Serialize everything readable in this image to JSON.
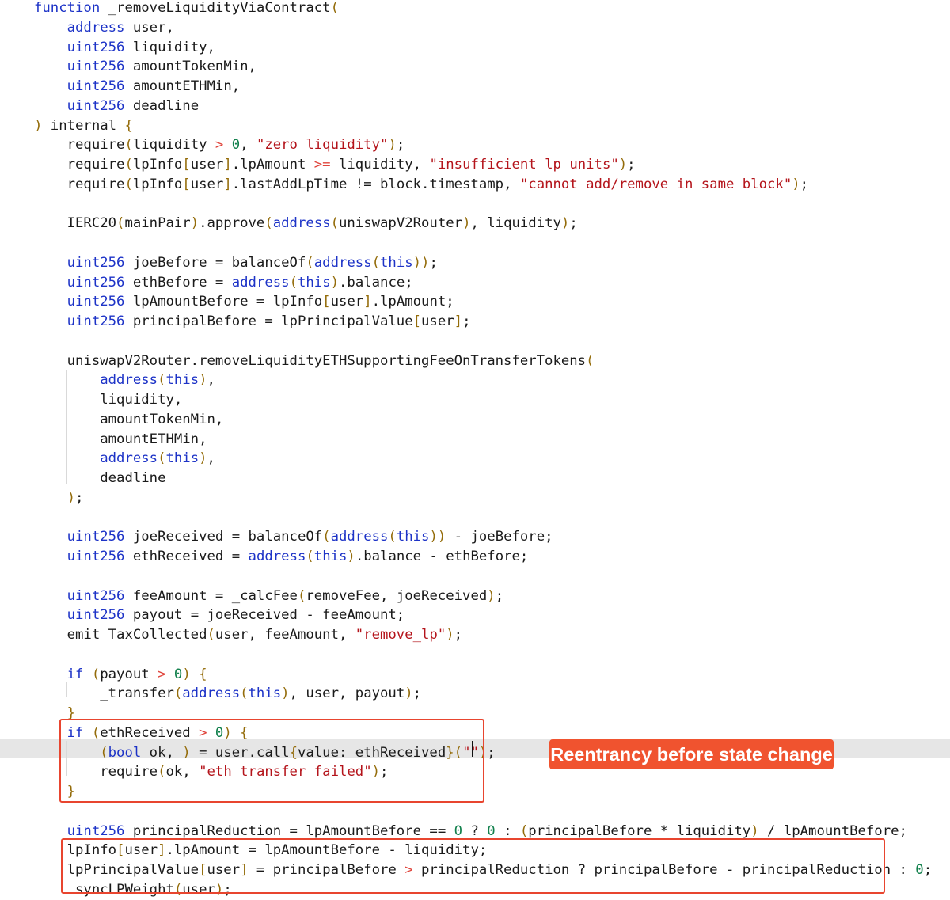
{
  "editor": {
    "lines": [
      [
        [
          "kw",
          "function"
        ],
        [
          "t",
          " _removeLiquidityViaContract"
        ],
        [
          "br",
          "("
        ]
      ],
      [
        [
          "t",
          "    "
        ],
        [
          "ty",
          "address"
        ],
        [
          "t",
          " user,"
        ]
      ],
      [
        [
          "t",
          "    "
        ],
        [
          "ty",
          "uint256"
        ],
        [
          "t",
          " liquidity,"
        ]
      ],
      [
        [
          "t",
          "    "
        ],
        [
          "ty",
          "uint256"
        ],
        [
          "t",
          " amountTokenMin,"
        ]
      ],
      [
        [
          "t",
          "    "
        ],
        [
          "ty",
          "uint256"
        ],
        [
          "t",
          " amountETHMin,"
        ]
      ],
      [
        [
          "t",
          "    "
        ],
        [
          "ty",
          "uint256"
        ],
        [
          "t",
          " deadline"
        ]
      ],
      [
        [
          "br",
          ")"
        ],
        [
          "t",
          " internal "
        ],
        [
          "br",
          "{"
        ]
      ],
      [
        [
          "t",
          "    require"
        ],
        [
          "br",
          "("
        ],
        [
          "t",
          "liquidity "
        ],
        [
          "op",
          ">"
        ],
        [
          "t",
          " "
        ],
        [
          "num",
          "0"
        ],
        [
          "t",
          ", "
        ],
        [
          "str",
          "\"zero liquidity\""
        ],
        [
          "br",
          ")"
        ],
        [
          "t",
          ";"
        ]
      ],
      [
        [
          "t",
          "    require"
        ],
        [
          "br",
          "("
        ],
        [
          "t",
          "lpInfo"
        ],
        [
          "br",
          "["
        ],
        [
          "t",
          "user"
        ],
        [
          "br",
          "]"
        ],
        [
          "t",
          ".lpAmount "
        ],
        [
          "op",
          ">="
        ],
        [
          "t",
          " liquidity, "
        ],
        [
          "str",
          "\"insufficient lp units\""
        ],
        [
          "br",
          ")"
        ],
        [
          "t",
          ";"
        ]
      ],
      [
        [
          "t",
          "    require"
        ],
        [
          "br",
          "("
        ],
        [
          "t",
          "lpInfo"
        ],
        [
          "br",
          "["
        ],
        [
          "t",
          "user"
        ],
        [
          "br",
          "]"
        ],
        [
          "t",
          ".lastAddLpTime != block.timestamp, "
        ],
        [
          "str",
          "\"cannot add/remove in same block\""
        ],
        [
          "br",
          ")"
        ],
        [
          "t",
          ";"
        ]
      ],
      [],
      [
        [
          "t",
          "    IERC20"
        ],
        [
          "br",
          "("
        ],
        [
          "t",
          "mainPair"
        ],
        [
          "br",
          ")"
        ],
        [
          "t",
          ".approve"
        ],
        [
          "br",
          "("
        ],
        [
          "ty",
          "address"
        ],
        [
          "br",
          "("
        ],
        [
          "t",
          "uniswapV2Router"
        ],
        [
          "br",
          ")"
        ],
        [
          "t",
          ", liquidity"
        ],
        [
          "br",
          ")"
        ],
        [
          "t",
          ";"
        ]
      ],
      [],
      [
        [
          "t",
          "    "
        ],
        [
          "ty",
          "uint256"
        ],
        [
          "t",
          " joeBefore = balanceOf"
        ],
        [
          "br",
          "("
        ],
        [
          "ty",
          "address"
        ],
        [
          "br",
          "("
        ],
        [
          "kw",
          "this"
        ],
        [
          "br",
          "))"
        ],
        [
          "t",
          ";"
        ]
      ],
      [
        [
          "t",
          "    "
        ],
        [
          "ty",
          "uint256"
        ],
        [
          "t",
          " ethBefore = "
        ],
        [
          "ty",
          "address"
        ],
        [
          "br",
          "("
        ],
        [
          "kw",
          "this"
        ],
        [
          "br",
          ")"
        ],
        [
          "t",
          ".balance;"
        ]
      ],
      [
        [
          "t",
          "    "
        ],
        [
          "ty",
          "uint256"
        ],
        [
          "t",
          " lpAmountBefore = lpInfo"
        ],
        [
          "br",
          "["
        ],
        [
          "t",
          "user"
        ],
        [
          "br",
          "]"
        ],
        [
          "t",
          ".lpAmount;"
        ]
      ],
      [
        [
          "t",
          "    "
        ],
        [
          "ty",
          "uint256"
        ],
        [
          "t",
          " principalBefore = lpPrincipalValue"
        ],
        [
          "br",
          "["
        ],
        [
          "t",
          "user"
        ],
        [
          "br",
          "]"
        ],
        [
          "t",
          ";"
        ]
      ],
      [],
      [
        [
          "t",
          "    uniswapV2Router.removeLiquidityETHSupportingFeeOnTransferTokens"
        ],
        [
          "br",
          "("
        ]
      ],
      [
        [
          "t",
          "        "
        ],
        [
          "ty",
          "address"
        ],
        [
          "br",
          "("
        ],
        [
          "kw",
          "this"
        ],
        [
          "br",
          ")"
        ],
        [
          "t",
          ","
        ]
      ],
      [
        [
          "t",
          "        liquidity,"
        ]
      ],
      [
        [
          "t",
          "        amountTokenMin,"
        ]
      ],
      [
        [
          "t",
          "        amountETHMin,"
        ]
      ],
      [
        [
          "t",
          "        "
        ],
        [
          "ty",
          "address"
        ],
        [
          "br",
          "("
        ],
        [
          "kw",
          "this"
        ],
        [
          "br",
          ")"
        ],
        [
          "t",
          ","
        ]
      ],
      [
        [
          "t",
          "        deadline"
        ]
      ],
      [
        [
          "t",
          "    "
        ],
        [
          "br",
          ")"
        ],
        [
          "t",
          ";"
        ]
      ],
      [],
      [
        [
          "t",
          "    "
        ],
        [
          "ty",
          "uint256"
        ],
        [
          "t",
          " joeReceived = balanceOf"
        ],
        [
          "br",
          "("
        ],
        [
          "ty",
          "address"
        ],
        [
          "br",
          "("
        ],
        [
          "kw",
          "this"
        ],
        [
          "br",
          "))"
        ],
        [
          "t",
          " - joeBefore;"
        ]
      ],
      [
        [
          "t",
          "    "
        ],
        [
          "ty",
          "uint256"
        ],
        [
          "t",
          " ethReceived = "
        ],
        [
          "ty",
          "address"
        ],
        [
          "br",
          "("
        ],
        [
          "kw",
          "this"
        ],
        [
          "br",
          ")"
        ],
        [
          "t",
          ".balance - ethBefore;"
        ]
      ],
      [],
      [
        [
          "t",
          "    "
        ],
        [
          "ty",
          "uint256"
        ],
        [
          "t",
          " feeAmount = _calcFee"
        ],
        [
          "br",
          "("
        ],
        [
          "t",
          "removeFee, joeReceived"
        ],
        [
          "br",
          ")"
        ],
        [
          "t",
          ";"
        ]
      ],
      [
        [
          "t",
          "    "
        ],
        [
          "ty",
          "uint256"
        ],
        [
          "t",
          " payout = joeReceived - feeAmount;"
        ]
      ],
      [
        [
          "t",
          "    emit TaxCollected"
        ],
        [
          "br",
          "("
        ],
        [
          "t",
          "user, feeAmount, "
        ],
        [
          "str",
          "\"remove_lp\""
        ],
        [
          "br",
          ")"
        ],
        [
          "t",
          ";"
        ]
      ],
      [],
      [
        [
          "t",
          "    "
        ],
        [
          "kw",
          "if"
        ],
        [
          "t",
          " "
        ],
        [
          "br",
          "("
        ],
        [
          "t",
          "payout "
        ],
        [
          "op",
          ">"
        ],
        [
          "t",
          " "
        ],
        [
          "num",
          "0"
        ],
        [
          "br",
          ")"
        ],
        [
          "t",
          " "
        ],
        [
          "br",
          "{"
        ]
      ],
      [
        [
          "t",
          "        _transfer"
        ],
        [
          "br",
          "("
        ],
        [
          "ty",
          "address"
        ],
        [
          "br",
          "("
        ],
        [
          "kw",
          "this"
        ],
        [
          "br",
          ")"
        ],
        [
          "t",
          ", user, payout"
        ],
        [
          "br",
          ")"
        ],
        [
          "t",
          ";"
        ]
      ],
      [
        [
          "t",
          "    "
        ],
        [
          "br",
          "}"
        ]
      ],
      [
        [
          "t",
          "    "
        ],
        [
          "kw",
          "if"
        ],
        [
          "t",
          " "
        ],
        [
          "br",
          "("
        ],
        [
          "t",
          "ethReceived "
        ],
        [
          "op",
          ">"
        ],
        [
          "t",
          " "
        ],
        [
          "num",
          "0"
        ],
        [
          "br",
          ")"
        ],
        [
          "t",
          " "
        ],
        [
          "br",
          "{"
        ]
      ],
      [
        [
          "t",
          "        "
        ],
        [
          "br",
          "("
        ],
        [
          "ty",
          "bool"
        ],
        [
          "t",
          " ok, "
        ],
        [
          "br",
          ")"
        ],
        [
          "t",
          " = user.call"
        ],
        [
          "br",
          "{"
        ],
        [
          "t",
          "value: ethReceived"
        ],
        [
          "br",
          "}"
        ],
        [
          "br",
          "("
        ],
        [
          "str",
          "\"\""
        ],
        [
          "br",
          ")"
        ],
        [
          "t",
          ";"
        ]
      ],
      [
        [
          "t",
          "        require"
        ],
        [
          "br",
          "("
        ],
        [
          "t",
          "ok, "
        ],
        [
          "str",
          "\"eth transfer failed\""
        ],
        [
          "br",
          ")"
        ],
        [
          "t",
          ";"
        ]
      ],
      [
        [
          "t",
          "    "
        ],
        [
          "br",
          "}"
        ]
      ],
      [],
      [
        [
          "t",
          "    "
        ],
        [
          "ty",
          "uint256"
        ],
        [
          "t",
          " principalReduction = lpAmountBefore == "
        ],
        [
          "num",
          "0"
        ],
        [
          "t",
          " ? "
        ],
        [
          "num",
          "0"
        ],
        [
          "t",
          " : "
        ],
        [
          "br",
          "("
        ],
        [
          "t",
          "principalBefore * liquidity"
        ],
        [
          "br",
          ")"
        ],
        [
          "t",
          " / lpAmountBefore;"
        ]
      ],
      [
        [
          "t",
          "    lpInfo"
        ],
        [
          "br",
          "["
        ],
        [
          "t",
          "user"
        ],
        [
          "br",
          "]"
        ],
        [
          "t",
          ".lpAmount = lpAmountBefore - liquidity;"
        ]
      ],
      [
        [
          "t",
          "    lpPrincipalValue"
        ],
        [
          "br",
          "["
        ],
        [
          "t",
          "user"
        ],
        [
          "br",
          "]"
        ],
        [
          "t",
          " = principalBefore "
        ],
        [
          "op",
          ">"
        ],
        [
          "t",
          " principalReduction ? principalBefore - principalReduction : "
        ],
        [
          "num",
          "0"
        ],
        [
          "t",
          ";"
        ]
      ],
      [
        [
          "t",
          "     syncLPWeight"
        ],
        [
          "br",
          "("
        ],
        [
          "t",
          "user"
        ],
        [
          "br",
          ")"
        ],
        [
          "t",
          ";"
        ]
      ]
    ]
  },
  "annotation": {
    "label": "Reentrancy before state change"
  }
}
